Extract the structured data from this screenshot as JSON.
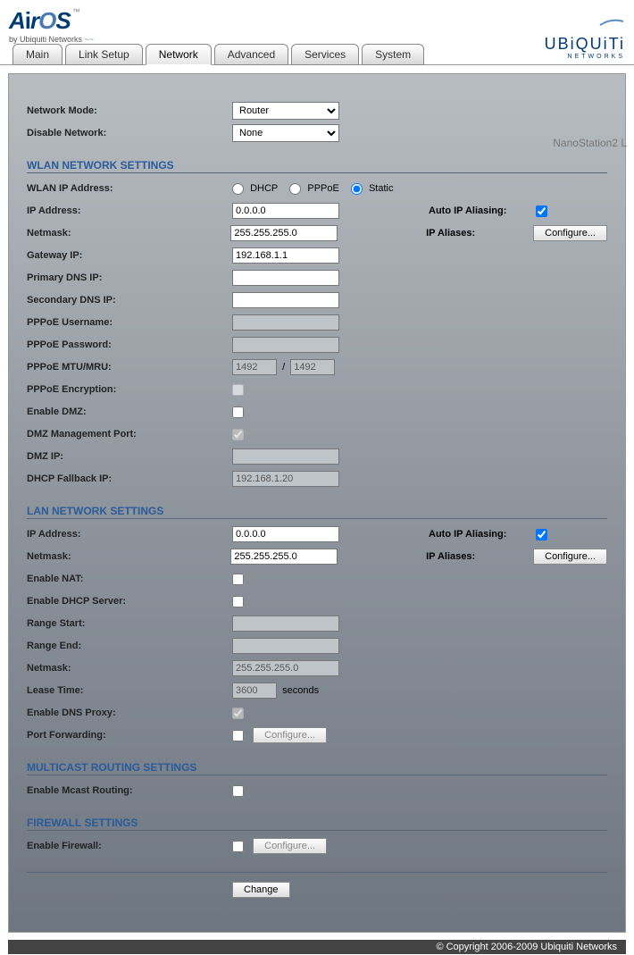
{
  "branding": {
    "logo_text": "AirOS",
    "logo_sub": "by Ubiquiti Networks",
    "right_brand": "UBiQUiTi",
    "right_sub": "NETWORKS",
    "model": "NanoStation2 L"
  },
  "tabs": [
    "Main",
    "Link Setup",
    "Network",
    "Advanced",
    "Services",
    "System"
  ],
  "active_tab": "Network",
  "top": {
    "network_mode_label": "Network Mode:",
    "network_mode_value": "Router",
    "disable_network_label": "Disable Network:",
    "disable_network_value": "None"
  },
  "wlan": {
    "header": "WLAN NETWORK SETTINGS",
    "ip_mode_label": "WLAN IP Address:",
    "ip_mode_options": {
      "dhcp": "DHCP",
      "pppoe": "PPPoE",
      "static": "Static"
    },
    "ip_mode_selected": "static",
    "ip_address_label": "IP Address:",
    "ip_address": "0.0.0.0",
    "netmask_label": "Netmask:",
    "netmask": "255.255.255.0",
    "gateway_label": "Gateway IP:",
    "gateway": "192.168.1.1",
    "dns1_label": "Primary DNS IP:",
    "dns1": "",
    "dns2_label": "Secondary DNS IP:",
    "dns2": "",
    "pppoe_user_label": "PPPoE Username:",
    "pppoe_pass_label": "PPPoE Password:",
    "pppoe_mtu_label": "PPPoE MTU/MRU:",
    "pppoe_mtu": "1492",
    "pppoe_mru": "1492",
    "pppoe_enc_label": "PPPoE Encryption:",
    "enable_dmz_label": "Enable DMZ:",
    "dmz_port_label": "DMZ Management Port:",
    "dmz_ip_label": "DMZ IP:",
    "dhcp_fallback_label": "DHCP Fallback IP:",
    "dhcp_fallback": "192.168.1.20",
    "auto_ip_label": "Auto IP Aliasing:",
    "ip_aliases_label": "IP Aliases:",
    "configure_btn": "Configure..."
  },
  "lan": {
    "header": "LAN NETWORK SETTINGS",
    "ip_address_label": "IP Address:",
    "ip_address": "0.0.0.0",
    "netmask_label": "Netmask:",
    "netmask": "255.255.255.0",
    "enable_nat_label": "Enable NAT:",
    "enable_dhcp_label": "Enable DHCP Server:",
    "range_start_label": "Range Start:",
    "range_end_label": "Range End:",
    "dhcp_netmask_label": "Netmask:",
    "dhcp_netmask": "255.255.255.0",
    "lease_time_label": "Lease Time:",
    "lease_time": "3600",
    "lease_time_unit": "seconds",
    "dns_proxy_label": "Enable DNS Proxy:",
    "port_fwd_label": "Port Forwarding:",
    "auto_ip_label": "Auto IP Aliasing:",
    "ip_aliases_label": "IP Aliases:",
    "configure_btn": "Configure..."
  },
  "mcast": {
    "header": "MULTICAST ROUTING SETTINGS",
    "enable_label": "Enable Mcast Routing:"
  },
  "firewall": {
    "header": "FIREWALL SETTINGS",
    "enable_label": "Enable Firewall:",
    "configure_btn": "Configure..."
  },
  "change_btn": "Change",
  "footer": "© Copyright 2006-2009 Ubiquiti Networks"
}
